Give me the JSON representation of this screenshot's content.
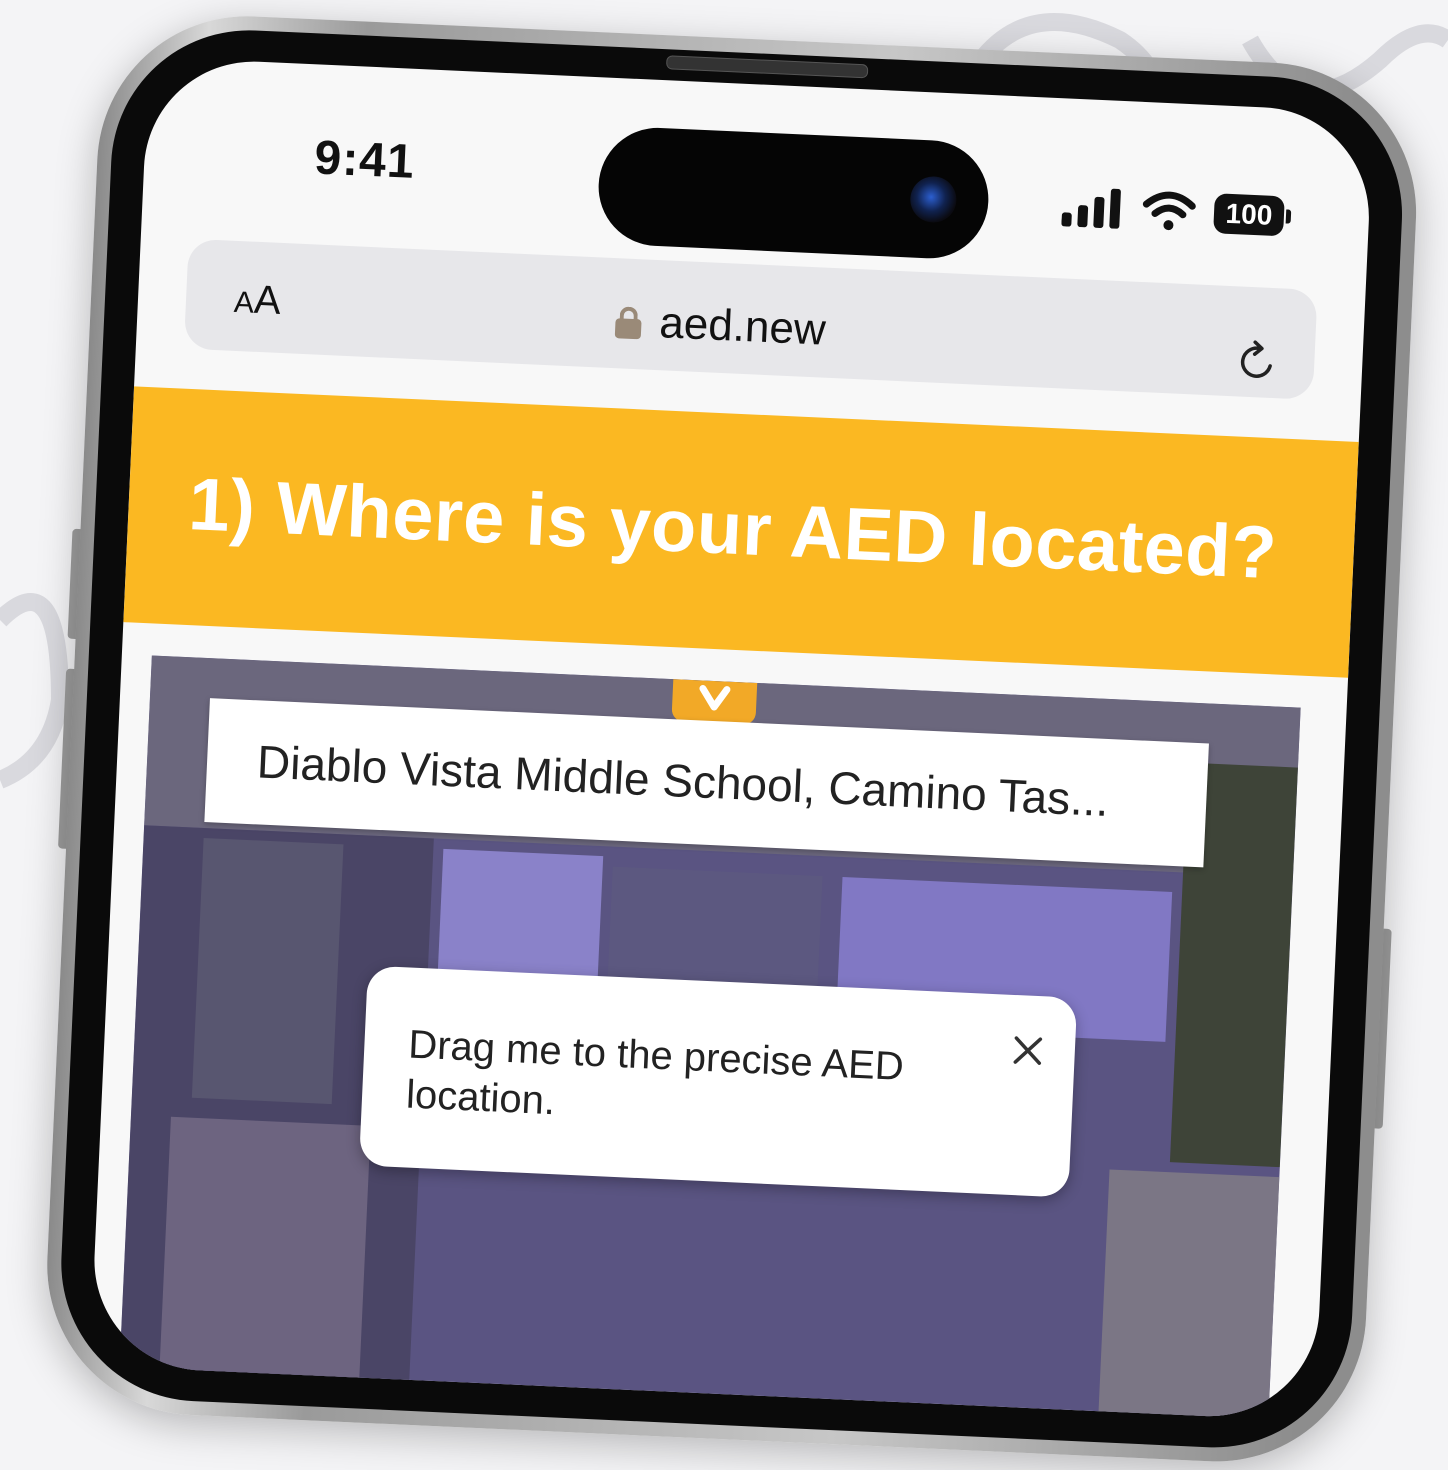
{
  "status_bar": {
    "time": "9:41",
    "battery": "100",
    "icons": [
      "signal-bars-icon",
      "wifi-icon",
      "battery-icon"
    ]
  },
  "browser": {
    "text_size_label_small": "A",
    "text_size_label_large": "A",
    "url": "aed.new",
    "icons": [
      "lock-icon",
      "reload-icon"
    ]
  },
  "page": {
    "banner_title": "1) Where is your AED located?",
    "banner_color": "#fbb822",
    "location_search_value": "Diablo Vista Middle School, Camino Tas...",
    "tooltip_text": "Drag me to the precise AED location.",
    "tooltip_close_icon": "close-icon"
  }
}
